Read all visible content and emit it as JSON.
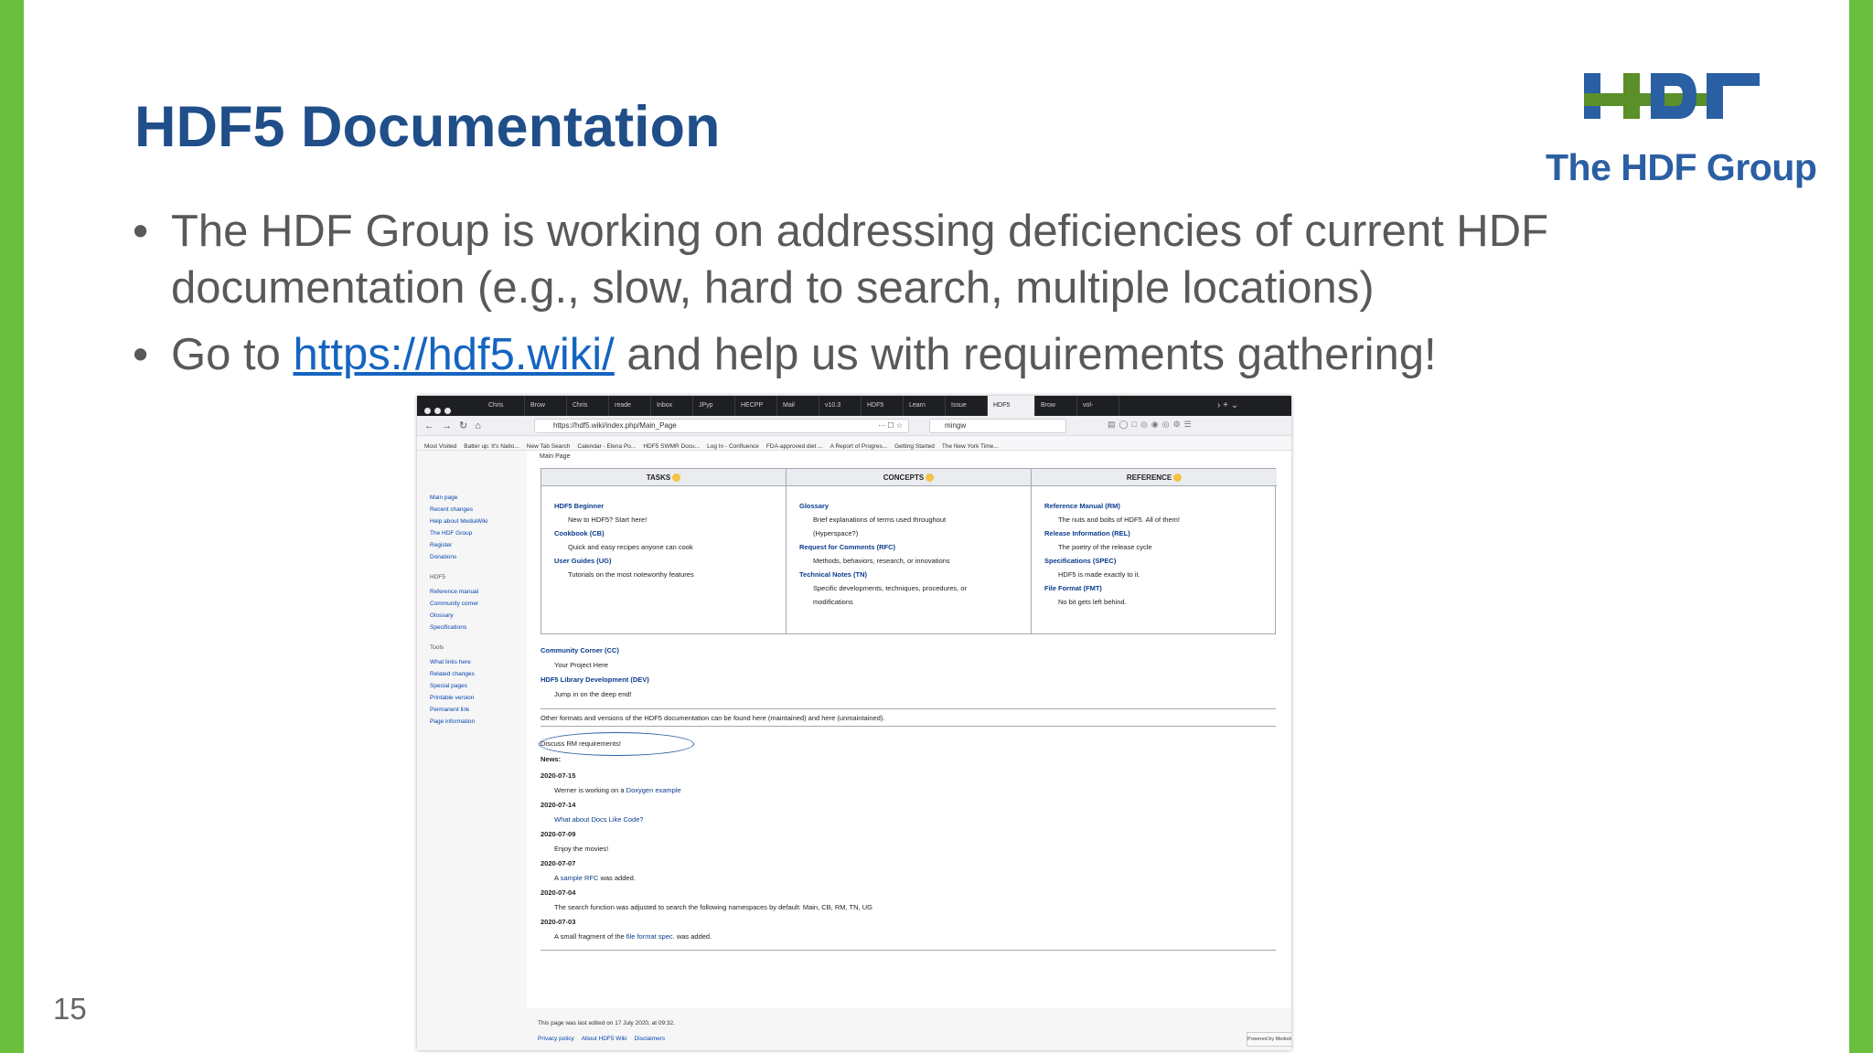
{
  "slide": {
    "title": "HDF5 Documentation",
    "bullet1": "The HDF Group is working on addressing deficiencies of current HDF documentation (e.g., slow, hard to search, multiple locations)",
    "bullet2_prefix": "Go to ",
    "bullet2_link": "https://hdf5.wiki/",
    "bullet2_suffix": " and help us with requirements gathering!",
    "page_number": "15",
    "logo_text": "The HDF Group",
    "colors": {
      "accent_green": "#6bbf3f",
      "title_blue": "#1f4e89",
      "link_blue": "#1565c0",
      "logo_blue": "#2b5fa3",
      "logo_green": "#5a8f29"
    }
  },
  "browser": {
    "tabs": [
      "Chris",
      "Brow",
      "Chris",
      "reade",
      "Inbox",
      "JPyp",
      "HECPP",
      "Mail",
      "v10.3",
      "HDF5",
      "Learn",
      "Issue",
      "HDF5",
      "Brow",
      "vol-"
    ],
    "active_tab_index": 12,
    "url": "https://hdf5.wiki/index.php/Main_Page",
    "search_value": "mingw",
    "bookmarks": [
      "Most Visited",
      "Batter up: It's Natio...",
      "New Tab Search",
      "Calendar - Elena Po...",
      "HDF5 SWMR Docu...",
      "Log In - Confluence",
      "FDA-approved diet ...",
      "A Report of Progres...",
      "Getting Started",
      "The New York Time..."
    ]
  },
  "wiki": {
    "page_tab": "Main Page",
    "sidebar": {
      "nav": [
        "Main page",
        "Recent changes",
        "Help about MediaWiki",
        "The HDF Group",
        "Register",
        "Donations"
      ],
      "hdf5_heading": "HDF5",
      "hdf5": [
        "Reference manual",
        "Community corner",
        "Glossary",
        "Specifications"
      ],
      "tools_heading": "Tools",
      "tools": [
        "What links here",
        "Related changes",
        "Special pages",
        "Printable version",
        "Permanent link",
        "Page information"
      ]
    },
    "columns": [
      {
        "header": "TASKS",
        "entries": [
          {
            "link": "HDF5 Beginner",
            "desc": "New to HDF5? Start here!"
          },
          {
            "link": "Cookbook (CB)",
            "desc": "Quick and easy recipes anyone can cook"
          },
          {
            "link": "User Guides (UG)",
            "desc": "Tutorials on the most noteworthy features"
          }
        ]
      },
      {
        "header": "CONCEPTS",
        "entries": [
          {
            "link": "Glossary",
            "desc": "Brief explanations of terms used throughout",
            "desc2": "(Hyperspace?)"
          },
          {
            "link": "Request for Comments (RFC)",
            "desc": "Methods, behaviors, research, or innovations"
          },
          {
            "link": "Technical Notes (TN)",
            "desc": "Specific developments, techniques, procedures, or",
            "desc2": "modifications"
          }
        ]
      },
      {
        "header": "REFERENCE",
        "entries": [
          {
            "link": "Reference Manual (RM)",
            "desc": "The nuts and bolts of HDF5. All of them!"
          },
          {
            "link": "Release Information (REL)",
            "desc": "The poetry of the release cycle"
          },
          {
            "link": "Specifications (SPEC)",
            "desc": "HDF5 is made exactly to it."
          },
          {
            "link": "File Format (FMT)",
            "desc": "No bit gets left behind."
          }
        ]
      }
    ],
    "community_link": "Community Corner (CC)",
    "community_desc": "Your Project Here",
    "dev_link": "HDF5 Library Development (DEV)",
    "dev_desc": "Jump in on the deep end!",
    "other_formats": "Other formats and versions of the HDF5 documentation can be found here (maintained) and here (unmaintained).",
    "discuss": "Discuss RM requirements!",
    "news_label": "News:",
    "news": [
      {
        "date": "2020-07-15",
        "text_pre": "Werner is working on a ",
        "text_link": "Doxygen example"
      },
      {
        "date": "2020-07-14",
        "text_pre": "",
        "text_link": "What about Docs Like Code?"
      },
      {
        "date": "2020-07-09",
        "text_pre": "Enjoy the movies!",
        "text_link": ""
      },
      {
        "date": "2020-07-07",
        "text_pre": "A ",
        "text_link": "sample RFC",
        "text_post": " was added."
      },
      {
        "date": "2020-07-04",
        "text_pre": "The search function was adjusted to search the following namespaces by default: Main, CB, RM, TN, UG",
        "text_link": ""
      },
      {
        "date": "2020-07-03",
        "text_pre": "A small fragment of the ",
        "text_link": "file format spec.",
        "text_post": " was added."
      }
    ],
    "last_edited": "This page was last edited on 17 July 2020, at 09:32.",
    "footer_links": [
      "Privacy policy",
      "About HDF5 Wiki",
      "Disclaimers"
    ],
    "powered_by": "Powered by MediaWiki"
  }
}
